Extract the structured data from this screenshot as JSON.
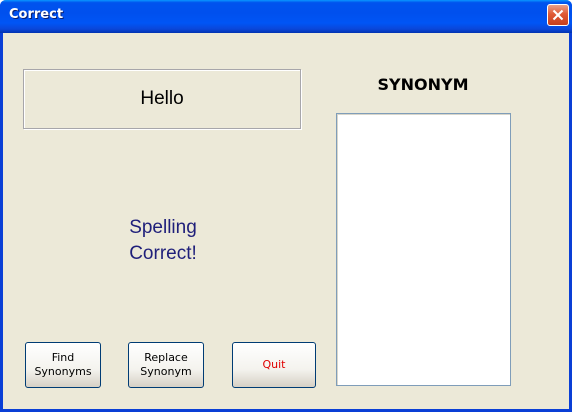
{
  "window": {
    "title": "Correct",
    "close_icon": "close-icon",
    "accent_color": "#0053EE",
    "close_color": "#E05A36"
  },
  "main": {
    "word": "Hello",
    "status_line1": "Spelling",
    "status_line2": "Correct!",
    "status_color": "#1F1F7A"
  },
  "synonyms": {
    "heading": "SYNONYM",
    "items": []
  },
  "buttons": {
    "find_line1": "Find",
    "find_line2": "Synonyms",
    "replace_line1": "Replace",
    "replace_line2": "Synonym",
    "quit": "Quit",
    "quit_color": "#E00000"
  }
}
